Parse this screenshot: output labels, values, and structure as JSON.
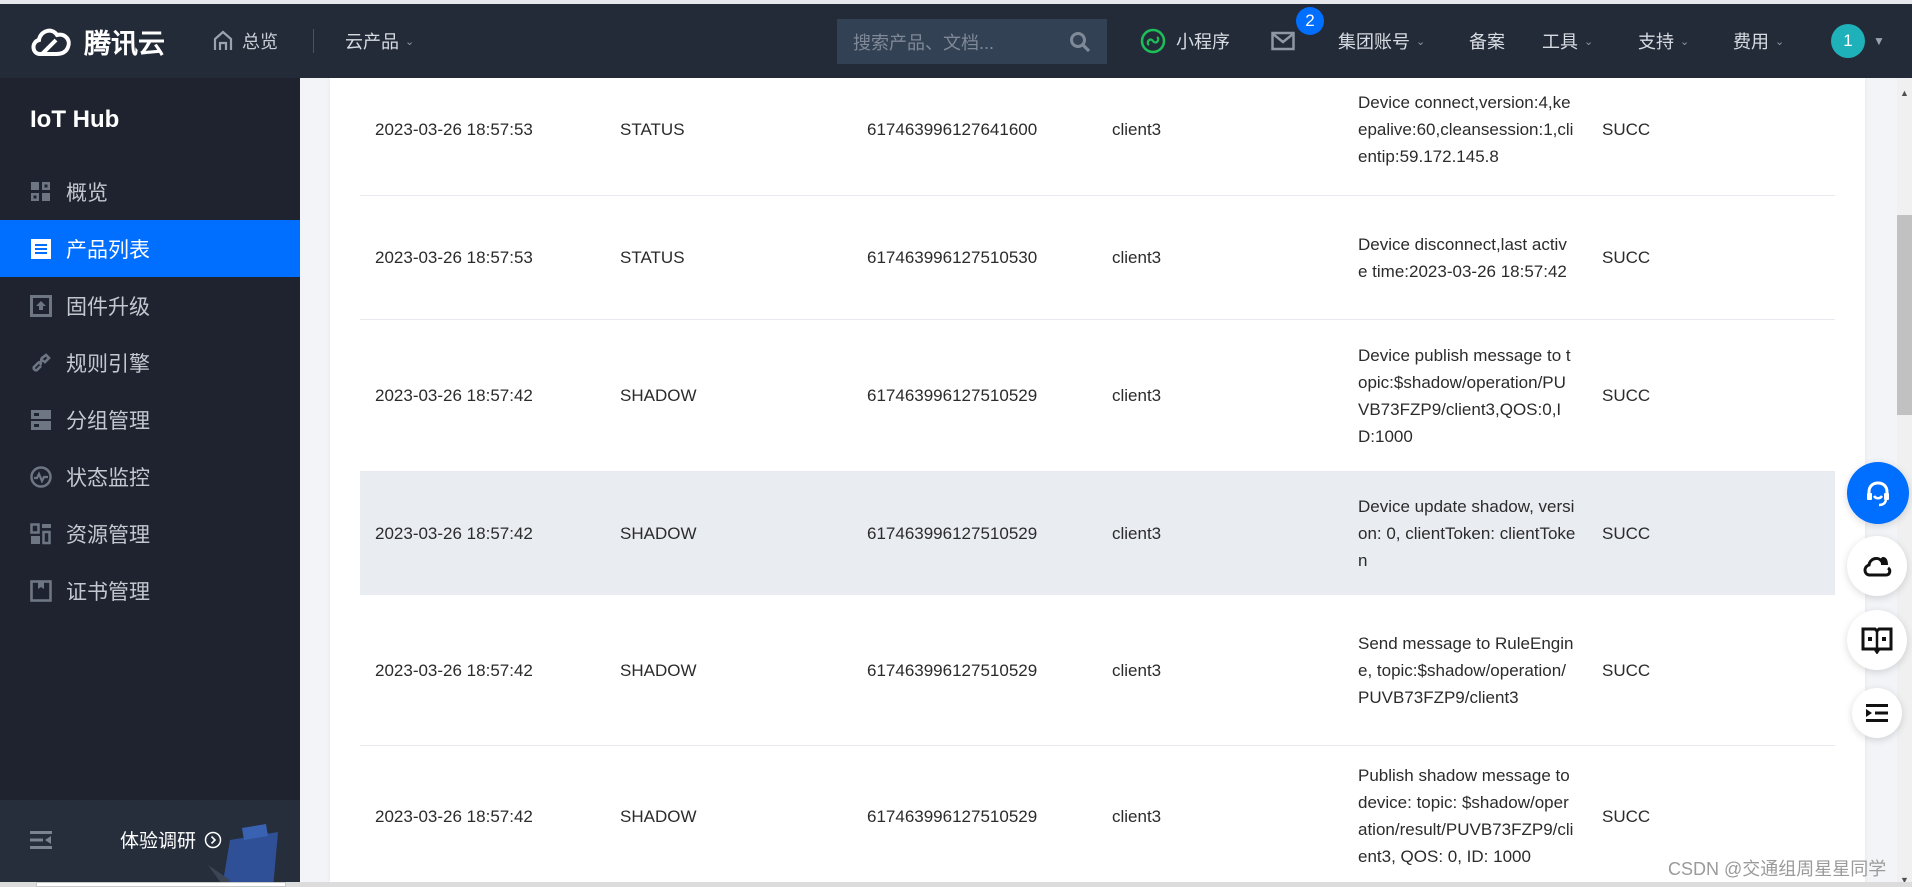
{
  "header": {
    "logo_text": "腾讯云",
    "home_label": "总览",
    "products_label": "云产品",
    "search_placeholder": "搜索产品、文档...",
    "mini_program_label": "小程序",
    "mail_badge_count": "2",
    "group_account_label": "集团账号",
    "beian_label": "备案",
    "tools_label": "工具",
    "support_label": "支持",
    "fees_label": "费用",
    "avatar_text": "1",
    "colors": {
      "bg": "#242b38",
      "accent": "#006eff",
      "avatar": "#1fb1b9",
      "mini_icon": "#1dbf59"
    }
  },
  "sidebar": {
    "title": "IoT Hub",
    "items": [
      {
        "label": "概览",
        "icon": "dashboard-icon",
        "active": false
      },
      {
        "label": "产品列表",
        "icon": "product-list-icon",
        "active": true
      },
      {
        "label": "固件升级",
        "icon": "firmware-upgrade-icon",
        "active": false
      },
      {
        "label": "规则引擎",
        "icon": "link-icon",
        "active": false
      },
      {
        "label": "分组管理",
        "icon": "group-icon",
        "active": false
      },
      {
        "label": "状态监控",
        "icon": "monitor-icon",
        "active": false
      },
      {
        "label": "资源管理",
        "icon": "resource-icon",
        "active": false
      },
      {
        "label": "证书管理",
        "icon": "certificate-icon",
        "active": false
      }
    ],
    "footer": {
      "survey_label": "体验调研"
    },
    "colors": {
      "bg": "#1f2330",
      "active": "#006eff"
    }
  },
  "table": {
    "rows": [
      {
        "time": "2023-03-26 18:57:53",
        "type": "STATUS",
        "id": "617463996127641600",
        "client": "client3",
        "message": "Device connect,version:4,keepalive:60,cleansession:1,clientip:59.172.145.8",
        "status": "SUCC",
        "highlight": false
      },
      {
        "time": "2023-03-26 18:57:53",
        "type": "STATUS",
        "id": "617463996127510530",
        "client": "client3",
        "message": "Device disconnect,last active time:2023-03-26 18:57:42",
        "status": "SUCC",
        "highlight": false
      },
      {
        "time": "2023-03-26 18:57:42",
        "type": "SHADOW",
        "id": "617463996127510529",
        "client": "client3",
        "message": "Device publish message to topic:$shadow/operation/PUVB73FZP9/client3,QOS:0,ID:1000",
        "status": "SUCC",
        "highlight": false
      },
      {
        "time": "2023-03-26 18:57:42",
        "type": "SHADOW",
        "id": "617463996127510529",
        "client": "client3",
        "message": "Device update shadow, version: 0, clientToken: clientToken",
        "status": "SUCC",
        "highlight": true
      },
      {
        "time": "2023-03-26 18:57:42",
        "type": "SHADOW",
        "id": "617463996127510529",
        "client": "client3",
        "message": "Send message to RuleEngine, topic:$shadow/operation/PUVB73FZP9/client3",
        "status": "SUCC",
        "highlight": false
      },
      {
        "time": "2023-03-26 18:57:42",
        "type": "SHADOW",
        "id": "617463996127510529",
        "client": "client3",
        "message": "Publish shadow message to device: topic: $shadow/operation/result/PUVB73FZP9/client3, QOS: 0, ID: 1000",
        "status": "SUCC",
        "highlight": false
      }
    ]
  },
  "floating_actions": [
    {
      "name": "customer-service-button",
      "icon": "headset-icon"
    },
    {
      "name": "cloud-notify-button",
      "icon": "cloud-bell-icon"
    },
    {
      "name": "docs-button",
      "icon": "book-icon"
    },
    {
      "name": "toc-button",
      "icon": "list-indent-icon"
    }
  ],
  "watermark": "CSDN @交通组周星星同学"
}
